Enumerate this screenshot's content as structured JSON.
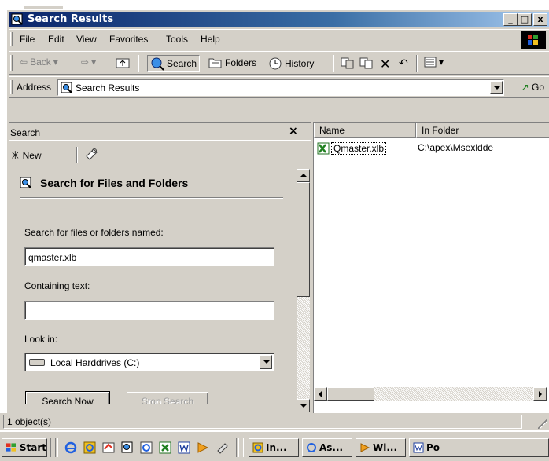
{
  "window": {
    "title": "Search Results",
    "controls": {
      "minimize": "_",
      "maximize": "□",
      "close": "x"
    }
  },
  "menu": [
    "File",
    "Edit",
    "View",
    "Favorites",
    "Tools",
    "Help"
  ],
  "toolbar": {
    "back": "Back",
    "search": "Search",
    "folders": "Folders",
    "history": "History"
  },
  "address": {
    "label": "Address",
    "value": "Search Results",
    "go": "Go"
  },
  "search_pane": {
    "header": "Search",
    "close": "×",
    "new_label": "New",
    "title": "Search for Files and Folders",
    "name_label": "Search for files or folders named:",
    "name_value": "qmaster.xlb",
    "text_label": "Containing text:",
    "text_value": "",
    "lookin_label": "Look in:",
    "lookin_value": "Local Harddrives (C:)",
    "search_now": "Search Now",
    "stop_search": "Stop Search"
  },
  "results": {
    "columns": [
      "Name",
      "In Folder"
    ],
    "rows": [
      {
        "name": "Qmaster.xlb",
        "folder": "C:\\apex\\Msexldde"
      }
    ]
  },
  "status": {
    "text": "1 object(s)"
  },
  "taskbar": {
    "start": "Start",
    "tasks": [
      "In...",
      "As...",
      "Wi...",
      "Po"
    ]
  },
  "colors": {
    "title_start": "#0a246a",
    "title_end": "#a6caf0",
    "face": "#d4d0c8",
    "shadow": "#808080"
  }
}
